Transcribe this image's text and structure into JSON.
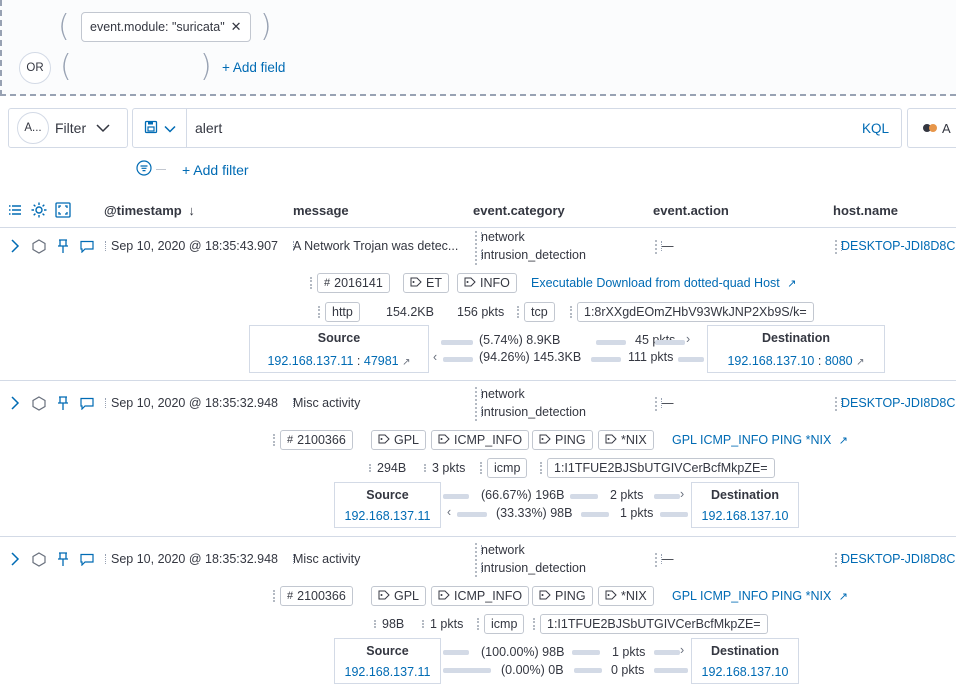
{
  "dropzone": {
    "pill_label": "event.module: \"suricata\"",
    "or_label": "OR",
    "add_field": "+ Add field"
  },
  "querybar": {
    "avatar_label": "A...",
    "filter_label": "Filter",
    "query_value": "alert",
    "kql_label": "KQL",
    "cut_label": "A"
  },
  "add_filter": "+ Add filter",
  "columns": {
    "timestamp": "@timestamp",
    "message": "message",
    "category": "event.category",
    "action": "event.action",
    "host": "host.name"
  },
  "rows": [
    {
      "timestamp": "Sep 10, 2020 @ 18:35:43.907",
      "message": "A Network Trojan was detec...",
      "category": [
        "network",
        "intrusion_detection"
      ],
      "action": "—",
      "host": "DESKTOP-JDI8D8C",
      "sig_id": "2016141",
      "tags": [
        "ET",
        "INFO"
      ],
      "signature": "Executable Download from dotted-quad Host",
      "proto": [
        "http",
        "154.2KB",
        "156 pkts",
        "tcp"
      ],
      "community_id": "1:8rXXgdEOmZHbV93WkJNP2Xb9S/k=",
      "source": {
        "title": "Source",
        "ip": "192.168.137.11",
        "port": "47981"
      },
      "destination": {
        "title": "Destination",
        "ip": "192.168.137.10",
        "port": "8080"
      },
      "out": {
        "pct": "(5.74%)",
        "bytes": "8.9KB",
        "pkts": "45 pkts"
      },
      "in": {
        "pct": "(94.26%)",
        "bytes": "145.3KB",
        "pkts": "111 pkts"
      }
    },
    {
      "timestamp": "Sep 10, 2020 @ 18:35:32.948",
      "message": "Misc activity",
      "category": [
        "network",
        "intrusion_detection"
      ],
      "action": "—",
      "host": "DESKTOP-JDI8D8C",
      "sig_id": "2100366",
      "tags": [
        "GPL",
        "ICMP_INFO",
        "PING",
        "*NIX"
      ],
      "signature": "GPL ICMP_INFO PING *NIX",
      "proto": [
        "294B",
        "3 pkts",
        "icmp"
      ],
      "community_id": "1:I1TFUE2BJSbUTGIVCerBcfMkpZE=",
      "source": {
        "title": "Source",
        "ip": "192.168.137.11"
      },
      "destination": {
        "title": "Destination",
        "ip": "192.168.137.10"
      },
      "out": {
        "pct": "(66.67%)",
        "bytes": "196B",
        "pkts": "2 pkts"
      },
      "in": {
        "pct": "(33.33%)",
        "bytes": "98B",
        "pkts": "1 pkts"
      }
    },
    {
      "timestamp": "Sep 10, 2020 @ 18:35:32.948",
      "message": "Misc activity",
      "category": [
        "network",
        "intrusion_detection"
      ],
      "action": "—",
      "host": "DESKTOP-JDI8D8C",
      "sig_id": "2100366",
      "tags": [
        "GPL",
        "ICMP_INFO",
        "PING",
        "*NIX"
      ],
      "signature": "GPL ICMP_INFO PING *NIX",
      "proto": [
        "98B",
        "1 pkts",
        "icmp"
      ],
      "community_id": "1:I1TFUE2BJSbUTGIVCerBcfMkpZE=",
      "source": {
        "title": "Source",
        "ip": "192.168.137.11"
      },
      "destination": {
        "title": "Destination",
        "ip": "192.168.137.10"
      },
      "out": {
        "pct": "(100.00%)",
        "bytes": "98B",
        "pkts": "1 pkts"
      },
      "in": {
        "pct": "(0.00%)",
        "bytes": "0B",
        "pkts": "0 pkts"
      }
    }
  ]
}
